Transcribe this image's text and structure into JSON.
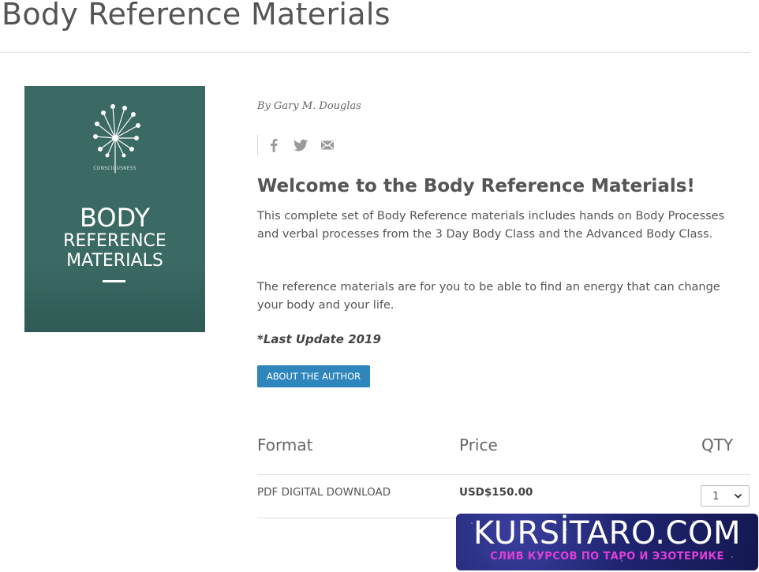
{
  "page": {
    "title": "Body Reference Materials"
  },
  "cover": {
    "brand": "CONSCIOUSNESS",
    "line1": "BODY",
    "line2": "REFERENCE",
    "line3": "MATERIALS",
    "background_color": "#3b6963",
    "icon": "dandelion-icon"
  },
  "product": {
    "author": "By Gary M. Douglas",
    "share_icons": [
      "facebook-icon",
      "twitter-icon",
      "email-icon"
    ],
    "heading": "Welcome to the Body Reference Materials!",
    "paragraph1": "This complete set of Body Reference materials includes hands on Body Processes and verbal processes from the 3 Day Body Class and the Advanced Body Class.",
    "paragraph2": "The reference materials are for you to be able to find an energy that can change your body and your life.",
    "update_note": "*Last Update 2019",
    "about_button": "ABOUT THE AUTHOR",
    "button_color": "#2e86bd"
  },
  "table": {
    "headers": [
      "Format",
      "Price",
      "QTY"
    ],
    "rows": [
      {
        "format": "PDF DIGITAL DOWNLOAD",
        "price": "USD$150.00",
        "qty": "1"
      }
    ]
  },
  "watermark": {
    "main": "KURSİTARO.COM",
    "sub": "СЛИВ КУРСОВ ПО ТАРО И ЭЗОТЕРИКЕ"
  }
}
